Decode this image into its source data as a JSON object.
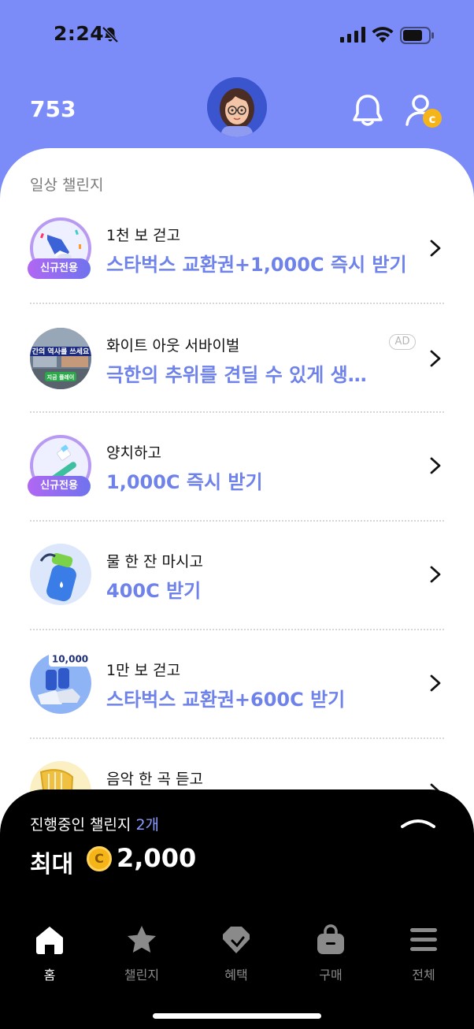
{
  "status_bar": {
    "time": "2:24",
    "icons": [
      "bell-slash-icon",
      "cellular-signal-icon",
      "wifi-icon",
      "battery-icon"
    ]
  },
  "header": {
    "points": "753",
    "icons": [
      "avatar",
      "bell-icon",
      "user-coin-icon"
    ],
    "accent_color": "#7b8cf8"
  },
  "section": {
    "title": "일상 챌린지"
  },
  "challenges": [
    {
      "label": "1천 보 걷고",
      "reward": "스타벅스 교환권+1,000C 즉시 받기",
      "badge": "신규전용",
      "ad": "",
      "icon": "sneaker-icon"
    },
    {
      "label": "화이트 아웃 서바이벌",
      "reward": "극한의 추위를 견딜 수 있게 생…",
      "badge": "",
      "ad": "AD",
      "icon": "game-banner-icon"
    },
    {
      "label": "양치하고",
      "reward": "1,000C 즉시 받기",
      "badge": "신규전용",
      "ad": "",
      "icon": "toothbrush-icon"
    },
    {
      "label": "물 한 잔 마시고",
      "reward": "400C 받기",
      "badge": "",
      "ad": "",
      "icon": "water-bottle-icon"
    },
    {
      "label": "1만 보 걷고",
      "reward": "스타벅스 교환권+600C 받기",
      "badge": "",
      "ad": "",
      "icon": "running-shoes-icon"
    },
    {
      "label": "음악 한 곡 듣고",
      "reward": "",
      "badge": "",
      "ad": "",
      "icon": "harp-icon"
    }
  ],
  "thumb_badges": {
    "steps_10000": "10,000",
    "game_tag": "지금 플레이"
  },
  "bottom_panel": {
    "progress_label": "진행중인 챌린지",
    "progress_count": "2개",
    "max_label": "최대",
    "coin_symbol": "C",
    "max_value": "2,000"
  },
  "nav": [
    {
      "label": "홈",
      "icon": "home-icon",
      "active": true
    },
    {
      "label": "챌린지",
      "icon": "star-icon",
      "active": false
    },
    {
      "label": "혜택",
      "icon": "tag-icon",
      "active": false
    },
    {
      "label": "구매",
      "icon": "shopping-bag-icon",
      "active": false
    },
    {
      "label": "전체",
      "icon": "menu-icon",
      "active": false
    }
  ],
  "colors": {
    "reward_text": "#6e82ea",
    "badge_gradient_start": "#b167f2",
    "badge_gradient_end": "#6f73ee",
    "coin": "#f5b417"
  }
}
